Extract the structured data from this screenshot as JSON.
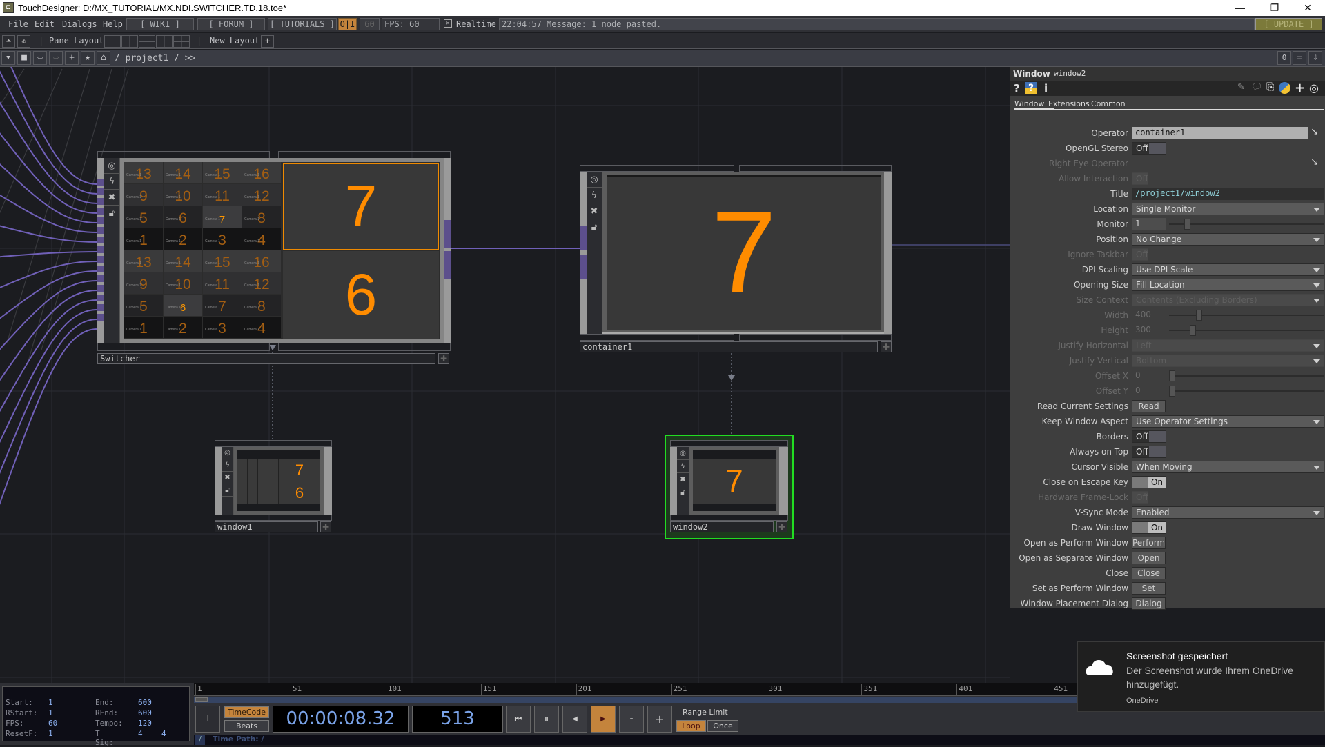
{
  "window": {
    "title": "TouchDesigner: D:/MX_TUTORIAL/MX.NDI.SWITCHER.TD.18.toe*",
    "minimize": "—",
    "restore": "❐",
    "close": "✕"
  },
  "menubar": {
    "items": [
      "File",
      "Edit",
      "Dialogs",
      "Help"
    ],
    "wiki": "[ WIKI ]",
    "forum": "[ FORUM ]",
    "tutorials": "[ TUTORIALS ]",
    "oi": "O|I",
    "fps_cap": "60",
    "fps": "FPS:  60",
    "realtime": "Realtime",
    "message": "22:04:57 Message: 1 node pasted.",
    "update": "[ UPDATE ]",
    "accent": "#c4843c"
  },
  "layoutbar": {
    "pane_layout": "Pane Layout",
    "new_layout": "New Layout",
    "plus": "+"
  },
  "pathbar": {
    "path": "/ project1 / >>",
    "right_value": "0"
  },
  "nodes": {
    "switcher": {
      "label": "Switcher",
      "grid_top": [
        "13",
        "14",
        "15",
        "16",
        "9",
        "10",
        "11",
        "12",
        "5",
        "6",
        "7",
        "8",
        "1",
        "2",
        "3",
        "4"
      ],
      "grid_bottom": [
        "13",
        "14",
        "15",
        "16",
        "9",
        "10",
        "11",
        "12",
        "5",
        "6",
        "7",
        "8",
        "1",
        "2",
        "3",
        "4"
      ],
      "cell_caption": "Camera 1",
      "preview_program": "7",
      "preview_preview": "6"
    },
    "container1": {
      "label": "container1",
      "display": "7"
    },
    "window1": {
      "label": "window1",
      "display_top": "7",
      "display_bottom": "6"
    },
    "window2": {
      "label": "window2",
      "display": "7",
      "selected_color": "#22dd22"
    }
  },
  "params": {
    "op_type": "Window",
    "op_name": "window2",
    "tabs": [
      "Window",
      "Extensions",
      "Common"
    ],
    "active_tab": "Window",
    "rows": {
      "operator": {
        "label": "Operator",
        "value": "container1"
      },
      "opengl_stereo": {
        "label": "OpenGL Stereo",
        "value": "Off"
      },
      "right_eye": {
        "label": "Right Eye Operator"
      },
      "allow_interaction": {
        "label": "Allow Interaction",
        "value": "Off"
      },
      "title": {
        "label": "Title",
        "value": "/project1/window2"
      },
      "location": {
        "label": "Location",
        "value": "Single Monitor"
      },
      "monitor": {
        "label": "Monitor",
        "value": "1"
      },
      "position": {
        "label": "Position",
        "value": "No Change"
      },
      "ignore_taskbar": {
        "label": "Ignore Taskbar",
        "value": "Off"
      },
      "dpi_scaling": {
        "label": "DPI Scaling",
        "value": "Use DPI Scale"
      },
      "opening_size": {
        "label": "Opening Size",
        "value": "Fill Location"
      },
      "size_context": {
        "label": "Size Context",
        "value": "Contents (Excluding Borders)"
      },
      "width": {
        "label": "Width",
        "value": "400"
      },
      "height": {
        "label": "Height",
        "value": "300"
      },
      "justify_h": {
        "label": "Justify Horizontal",
        "value": "Left"
      },
      "justify_v": {
        "label": "Justify Vertical",
        "value": "Bottom"
      },
      "offset_x": {
        "label": "Offset X",
        "value": "0"
      },
      "offset_y": {
        "label": "Offset Y",
        "value": "0"
      },
      "read_current": {
        "label": "Read Current Settings",
        "value": "Read"
      },
      "keep_aspect": {
        "label": "Keep Window Aspect",
        "value": "Use Operator Settings"
      },
      "borders": {
        "label": "Borders",
        "value": "Off"
      },
      "always_on_top": {
        "label": "Always on Top",
        "value": "Off"
      },
      "cursor_visible": {
        "label": "Cursor Visible",
        "value": "When Moving"
      },
      "close_on_escape": {
        "label": "Close on Escape Key",
        "value": "On"
      },
      "hw_framelock": {
        "label": "Hardware Frame-Lock",
        "value": "Off"
      },
      "vsync": {
        "label": "V-Sync Mode",
        "value": "Enabled"
      },
      "draw_window": {
        "label": "Draw Window",
        "value": "On"
      },
      "open_perform": {
        "label": "Open as Perform Window",
        "value": "Perform"
      },
      "open_separate": {
        "label": "Open as Separate Window",
        "value": "Open"
      },
      "close": {
        "label": "Close",
        "value": "Close"
      },
      "set_perform": {
        "label": "Set as Perform Window",
        "value": "Set"
      },
      "placement_dialog": {
        "label": "Window Placement Dialog",
        "value": "Dialog"
      }
    }
  },
  "timeline": {
    "start_label": "Start:",
    "start": "1",
    "end_label": "End:",
    "end": "600",
    "rstart_label": "RStart:",
    "rstart": "1",
    "rend_label": "REnd:",
    "rend": "600",
    "fps_label": "FPS:",
    "fps": "60",
    "tempo_label": "Tempo:",
    "tempo": "120",
    "resetf_label": "ResetF:",
    "resetf": "1",
    "tsig_label": "T Sig:",
    "tsig_a": "4",
    "tsig_b": "4",
    "ruler_ticks": [
      "1",
      "51",
      "101",
      "151",
      "201",
      "251",
      "301",
      "351",
      "401",
      "451"
    ],
    "timecode_btn": "TimeCode",
    "beats_btn": "Beats",
    "timecode": "00:00:08.32",
    "frame": "513",
    "minus": "-",
    "plus": "+",
    "range_limit": "Range Limit",
    "loop": "Loop",
    "once": "Once",
    "time_path": "Time Path: /",
    "slash": "/"
  },
  "toast": {
    "title": "Screenshot gespeichert",
    "body": "Der Screenshot wurde Ihrem OneDrive hinzugefügt.",
    "source": "OneDrive"
  }
}
